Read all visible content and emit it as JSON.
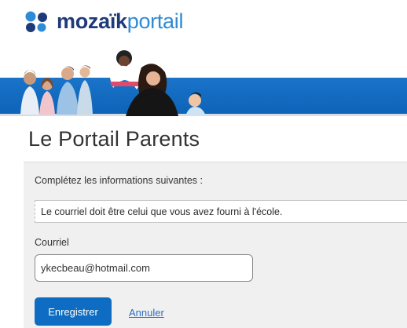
{
  "header": {
    "logo_bold": "mozaïk",
    "logo_light": "portail"
  },
  "page": {
    "title": "Le Portail Parents"
  },
  "form": {
    "instructions": "Complétez les informations suivantes :",
    "info_message": "Le courriel doit être celui que vous avez fourni à l'école.",
    "email_label": "Courriel",
    "email_value": "ykecbeau@hotmail.com",
    "save_label": "Enregistrer",
    "cancel_label": "Annuler"
  },
  "colors": {
    "brand_dark": "#1e3a78",
    "brand_light": "#2e8bd6",
    "banner_blue": "#0d63b8",
    "button_blue": "#0e6dc2",
    "link_blue": "#2c6fc4",
    "panel_bg": "#f0f0f0"
  }
}
